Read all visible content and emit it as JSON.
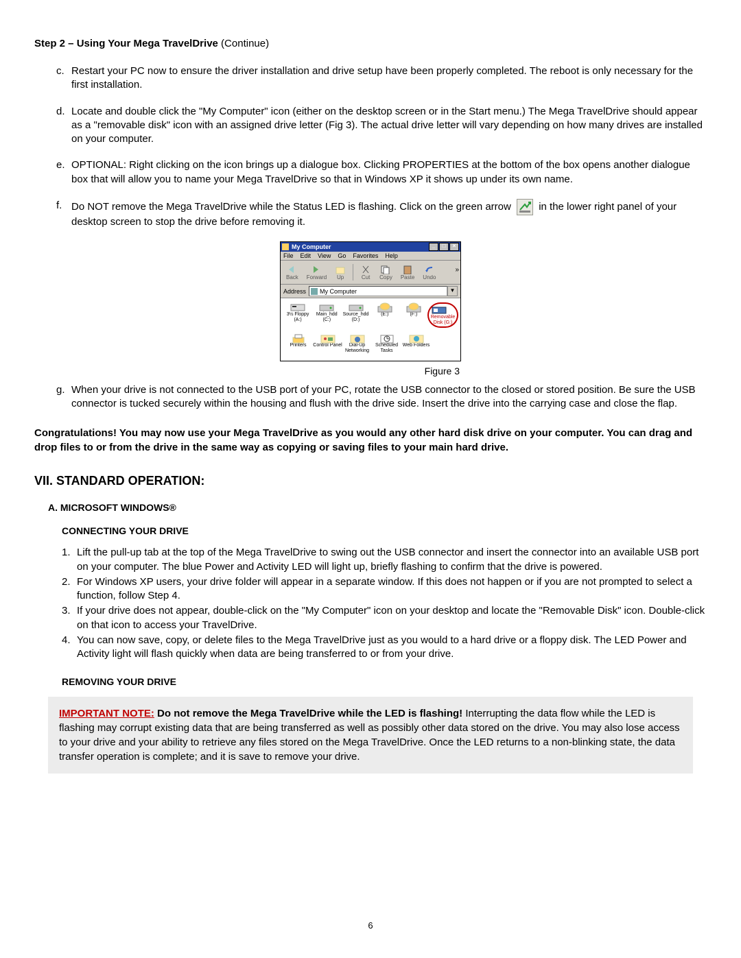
{
  "header": {
    "bold": "Step 2 – Using Your Mega TravelDrive",
    "cont": " (Continue)"
  },
  "items": {
    "c": "Restart your PC now to ensure the driver installation and drive setup have been properly completed. The reboot is only necessary for the first installation.",
    "d": "Locate and double click the \"My Computer\" icon (either on the desktop screen or in the Start menu.) The Mega TravelDrive should appear as a \"removable disk\" icon with an assigned drive letter (Fig 3). The actual drive letter will vary depending on how many drives are installed on your computer.",
    "e": "OPTIONAL: Right clicking on the icon brings up a dialogue box. Clicking PROPERTIES at the bottom of the box opens another dialogue box that will allow you to name your Mega TravelDrive so that in Windows XP it shows up under its own name.",
    "f_pre": "Do NOT remove the Mega TravelDrive while the Status LED is flashing. Click on the green arrow",
    "f_post": "in the lower right panel of your desktop screen to stop the drive before removing it.",
    "g": "When your drive is not connected to the USB port of your PC, rotate the USB connector to the closed or stored position.  Be sure the USB connector is tucked securely within the housing and flush with the drive side. Insert the drive into the carrying case and close the flap."
  },
  "figure": {
    "caption": "Figure 3",
    "title": "My Computer",
    "menus": [
      "File",
      "Edit",
      "View",
      "Go",
      "Favorites",
      "Help"
    ],
    "toolbar": [
      {
        "label": "Back",
        "dim": true
      },
      {
        "label": "Forward"
      },
      {
        "label": "Up"
      },
      {
        "label": "Cut"
      },
      {
        "label": "Copy"
      },
      {
        "label": "Paste"
      },
      {
        "label": "Undo"
      }
    ],
    "address_label": "Address",
    "address_value": "My Computer",
    "icons_row1": [
      {
        "label": "3½ Floppy (A:)"
      },
      {
        "label": "Main_hdd (C:)"
      },
      {
        "label": "Source_hdd (D:)"
      },
      {
        "label": "(E:)"
      },
      {
        "label": "(F:)"
      },
      {
        "label": "Removable Disk (G:)",
        "hl": true
      }
    ],
    "icons_row2": [
      {
        "label": "Printers"
      },
      {
        "label": "Control Panel"
      },
      {
        "label": "Dial-Up Networking"
      },
      {
        "label": "Scheduled Tasks"
      },
      {
        "label": "Web Folders"
      }
    ]
  },
  "congrats": "Congratulations!  You may now use your Mega TravelDrive as you would any other hard disk drive on your computer.  You can drag and drop files to or from the drive in the same way as copying or saving files to your main hard drive.",
  "section7": "VII. STANDARD OPERATION:",
  "subA": "A.  MICROSOFT WINDOWS®",
  "connHdr": "CONNECTING YOUR DRIVE",
  "conn": [
    "Lift the pull-up tab at the top of the Mega TravelDrive to swing out the USB connector and insert the connector into an available USB port on your computer.  The blue Power and Activity LED will light up, briefly flashing to confirm that the drive is powered.",
    "For Windows XP users, your drive folder will appear in a separate window.  If this does not happen or if you are not prompted to select a function, follow Step 4.",
    "If your drive does not appear, double-click on the \"My Computer\" icon on your desktop and locate the \"Removable Disk\" icon.  Double-click on that icon to access your TravelDrive.",
    "You can now save, copy, or delete files to the Mega TravelDrive just as you would to a hard drive or a floppy disk. The LED Power and Activity light will flash quickly when data are being transferred to or from your drive."
  ],
  "remHdr": "REMOVING YOUR DRIVE",
  "note": {
    "imp": "IMPORTANT NOTE:",
    "bold": "  Do not remove the Mega TravelDrive while the LED is flashing!",
    "rest": " Interrupting the data flow while the LED is flashing may corrupt existing data that are being transferred as well as possibly other data stored on the drive.  You may also lose access to your drive and your ability to retrieve any files stored on the Mega TravelDrive.  Once the LED returns to a non-blinking state, the data transfer operation is complete; and it is save to remove your drive."
  },
  "page": "6"
}
